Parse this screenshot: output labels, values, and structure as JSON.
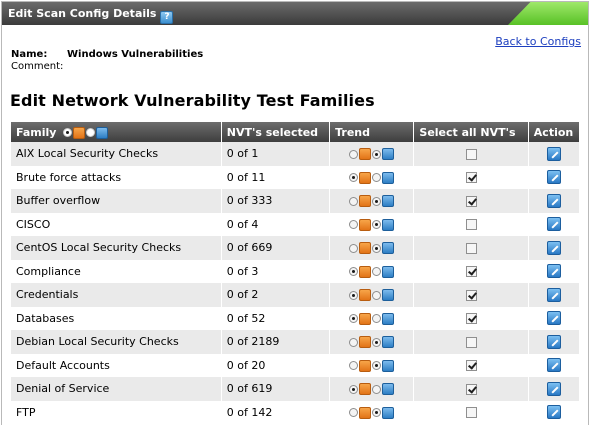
{
  "window": {
    "title": "Edit Scan Config Details"
  },
  "back_link": "Back to Configs",
  "config": {
    "name_label": "Name:",
    "name_value": "Windows Vulnerabilities",
    "comment_label": "Comment:"
  },
  "section_title": "Edit Network Vulnerability Test Families",
  "table": {
    "headers": {
      "family": "Family",
      "nvts": "NVT's selected",
      "trend": "Trend",
      "select_all": "Select all NVT's",
      "action": "Action"
    },
    "rows": [
      {
        "family": "AIX Local Security Checks",
        "nvts": "0 of 1",
        "trend": "dynamic",
        "selected": false
      },
      {
        "family": "Brute force attacks",
        "nvts": "0 of 11",
        "trend": "static",
        "selected": true
      },
      {
        "family": "Buffer overflow",
        "nvts": "0 of 333",
        "trend": "dynamic",
        "selected": true
      },
      {
        "family": "CISCO",
        "nvts": "0 of 4",
        "trend": "dynamic",
        "selected": false
      },
      {
        "family": "CentOS Local Security Checks",
        "nvts": "0 of 669",
        "trend": "dynamic",
        "selected": false
      },
      {
        "family": "Compliance",
        "nvts": "0 of 3",
        "trend": "static",
        "selected": true
      },
      {
        "family": "Credentials",
        "nvts": "0 of 2",
        "trend": "static",
        "selected": true
      },
      {
        "family": "Databases",
        "nvts": "0 of 52",
        "trend": "static",
        "selected": true
      },
      {
        "family": "Debian Local Security Checks",
        "nvts": "0 of 2189",
        "trend": "dynamic",
        "selected": false
      },
      {
        "family": "Default Accounts",
        "nvts": "0 of 20",
        "trend": "dynamic",
        "selected": true
      },
      {
        "family": "Denial of Service",
        "nvts": "0 of 619",
        "trend": "static",
        "selected": true
      },
      {
        "family": "FTP",
        "nvts": "0 of 142",
        "trend": "dynamic",
        "selected": false
      }
    ]
  },
  "icons": {
    "help": "help-icon",
    "trend_static": "trend-static-icon",
    "trend_dynamic": "trend-dynamic-icon",
    "edit": "edit-icon"
  },
  "colors": {
    "title_bar": "#3b3b3b",
    "title_accent": "#58c126",
    "link": "#1d3fbf",
    "row_alt": "#eaeaea",
    "trend_static": "#e27417",
    "trend_dynamic": "#2d7ec4"
  }
}
